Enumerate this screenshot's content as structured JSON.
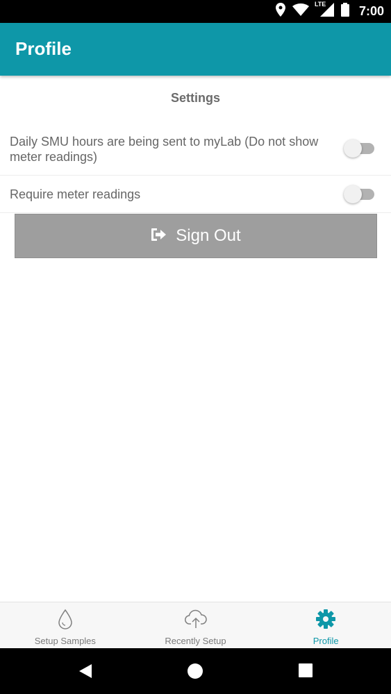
{
  "status_bar": {
    "time": "7:00",
    "network": "LTE",
    "icons": [
      "location-icon",
      "wifi-icon",
      "signal-icon",
      "battery-icon"
    ]
  },
  "app_bar": {
    "title": "Profile",
    "color": "#0e97a8"
  },
  "settings": {
    "header": "Settings",
    "items": [
      {
        "label": "Daily SMU hours are being sent to myLab (Do not show meter readings)",
        "enabled": false
      },
      {
        "label": "Require meter readings",
        "enabled": false
      }
    ]
  },
  "sign_out": {
    "label": "Sign Out",
    "icon": "sign-out-icon",
    "color": "#9e9e9e"
  },
  "bottom_nav": {
    "active_color": "#0e97a8",
    "items": [
      {
        "label": "Setup Samples",
        "icon": "droplet-icon",
        "active": false
      },
      {
        "label": "Recently Setup",
        "icon": "cloud-upload-icon",
        "active": false
      },
      {
        "label": "Profile",
        "icon": "gear-icon",
        "active": true
      }
    ]
  },
  "system_nav": {
    "buttons": [
      "back-icon",
      "home-icon",
      "recents-icon"
    ]
  }
}
